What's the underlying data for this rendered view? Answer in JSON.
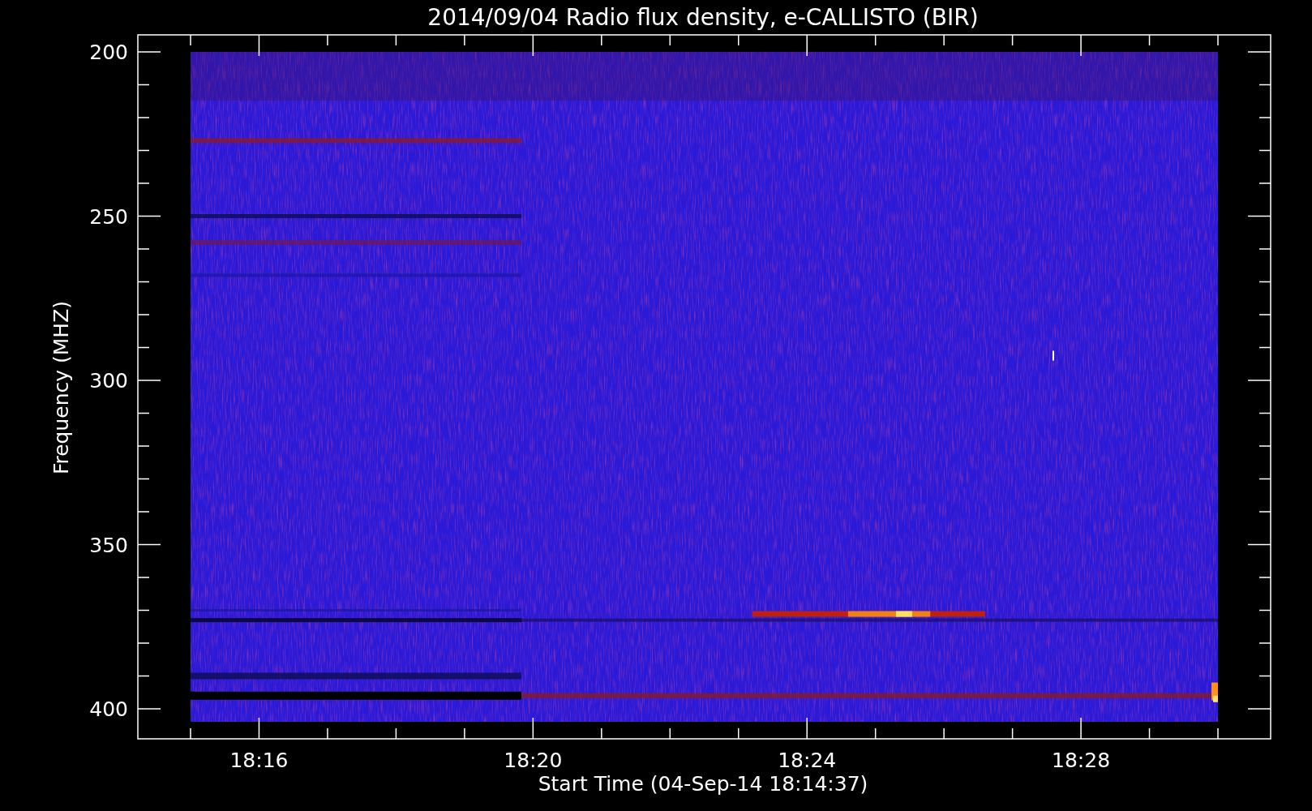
{
  "plot": {
    "title": "2014/09/04  Radio flux density, e-CALLISTO (BIR)",
    "ylabel": "Frequency (MHZ)",
    "xlabel": "Start Time (04-Sep-14 18:14:37)",
    "y_tick_labels": [
      "200",
      "250",
      "300",
      "350",
      "400"
    ],
    "x_tick_labels": [
      "18:16",
      "18:20",
      "18:24",
      "18:28"
    ]
  }
}
